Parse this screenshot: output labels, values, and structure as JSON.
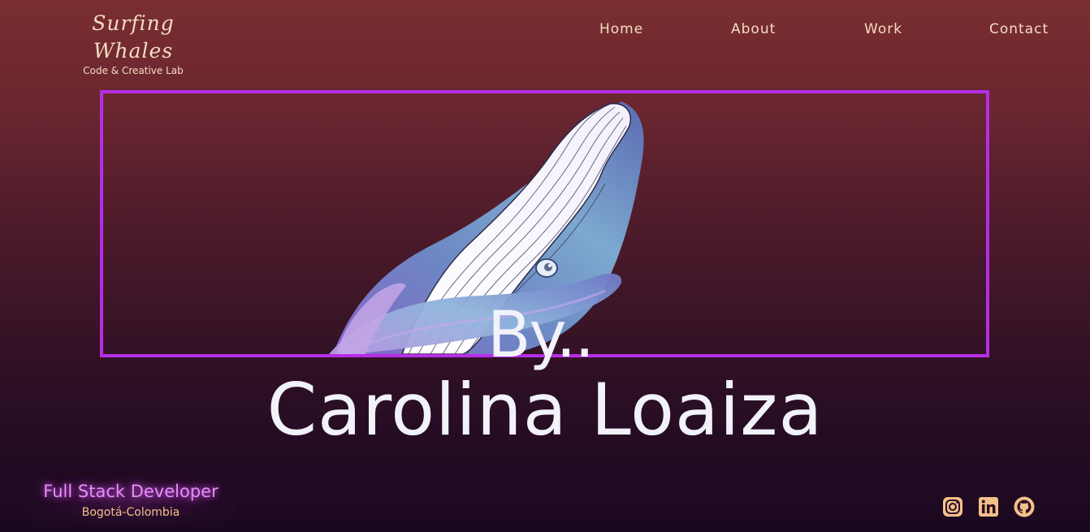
{
  "brand": {
    "title": "Surfing Whales",
    "subtitle": "Code & Creative Lab"
  },
  "nav": {
    "items": [
      {
        "label": "Home"
      },
      {
        "label": "About"
      },
      {
        "label": "Work"
      },
      {
        "label": "Contact"
      }
    ]
  },
  "hero": {
    "by": "By..",
    "name": "Carolina Loaiza",
    "frame_color": "#b52ee6"
  },
  "role": {
    "title": "Full Stack Developer",
    "location": "Bogotá-Colombia"
  },
  "socials": [
    {
      "icon": "instagram-icon"
    },
    {
      "icon": "linkedin-icon"
    },
    {
      "icon": "github-icon"
    }
  ],
  "colors": {
    "accent": "#b52ee6",
    "nav_text": "#f3dcc0",
    "role_glow": "#e98bff",
    "icon": "#f3c08a"
  }
}
